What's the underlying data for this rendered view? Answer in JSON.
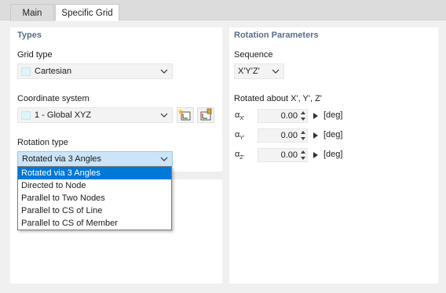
{
  "tabs": [
    {
      "label": "Main",
      "active": false
    },
    {
      "label": "Specific Grid",
      "active": true
    }
  ],
  "types": {
    "title": "Types",
    "grid_type": {
      "label": "Grid type",
      "value": "Cartesian",
      "swatch_color": "#dff4fb"
    },
    "coordinate_system": {
      "label": "Coordinate system",
      "value": "1 - Global XYZ",
      "swatch_color": "#dff4fb",
      "icons": [
        "new-coordinate-system-icon",
        "edit-coordinate-system-icon"
      ]
    },
    "rotation_type": {
      "label": "Rotation type",
      "value": "Rotated via 3 Angles",
      "options": [
        "Rotated via 3 Angles",
        "Directed to Node",
        "Parallel to Two Nodes",
        "Parallel to CS of Line",
        "Parallel to CS of Member"
      ],
      "selected_index": 0
    }
  },
  "rotation": {
    "title": "Rotation Parameters",
    "sequence": {
      "label": "Sequence",
      "value": "X'Y'Z'"
    },
    "about_label": "Rotated about X', Y', Z'",
    "angles": [
      {
        "symbol": "α",
        "sub": "X'",
        "value": "0.00",
        "unit": "[deg]"
      },
      {
        "symbol": "α",
        "sub": "Y'",
        "value": "0.00",
        "unit": "[deg]"
      },
      {
        "symbol": "α",
        "sub": "Z'",
        "value": "0.00",
        "unit": "[deg]"
      }
    ]
  },
  "colors": {
    "accent": "#0078d7",
    "section_title": "#5a6f8a",
    "panel_bg": "#ffffff",
    "window_bg": "#f0f0f0"
  }
}
